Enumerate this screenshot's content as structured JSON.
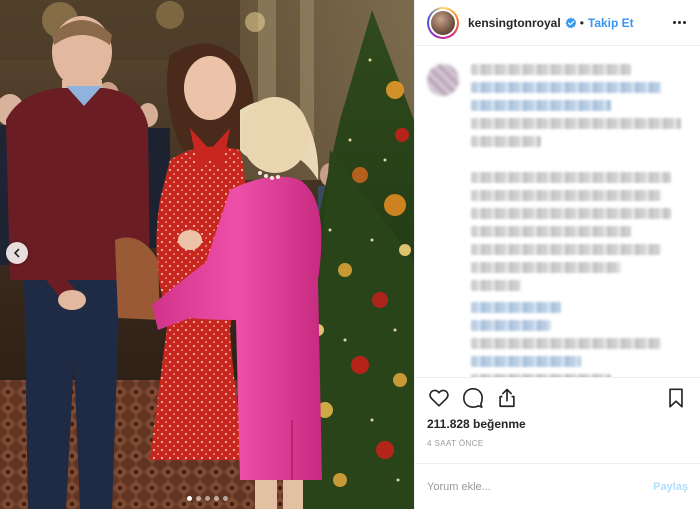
{
  "post": {
    "username": "kensingtonroyal",
    "separator": "•",
    "follow_label": "Takip Et",
    "likes_text": "211.828 beğenme",
    "time_ago": "4 SAAT ÖNCE",
    "comment_placeholder": "Yorum ekle...",
    "post_label": "Paylaş"
  },
  "carousel": {
    "slide_count": 5,
    "active_index": 0
  },
  "icons": {
    "verified": "verified-badge-icon",
    "more": "more-options-icon",
    "like": "heart-icon",
    "comment": "comment-icon",
    "share": "share-icon",
    "save": "bookmark-icon",
    "prev": "chevron-left-icon"
  },
  "colors": {
    "link": "#3897f0",
    "post_disabled": "#b2dffc",
    "text": "#262626",
    "muted": "#999999"
  }
}
